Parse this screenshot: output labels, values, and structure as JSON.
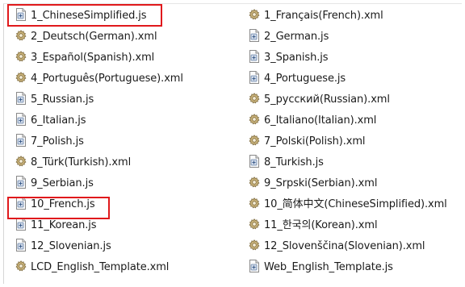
{
  "explorer": {
    "left_column": [
      {
        "name": "1_ChineseSimplified.js",
        "icon": "js-script-icon",
        "highlighted": true
      },
      {
        "name": "2_Deutsch(German).xml",
        "icon": "xml-gear-icon"
      },
      {
        "name": "3_Español(Spanish).xml",
        "icon": "xml-gear-icon"
      },
      {
        "name": "4_Português(Portuguese).xml",
        "icon": "xml-gear-icon"
      },
      {
        "name": "5_Russian.js",
        "icon": "js-script-icon"
      },
      {
        "name": "6_Italian.js",
        "icon": "js-script-icon"
      },
      {
        "name": "7_Polish.js",
        "icon": "js-script-icon"
      },
      {
        "name": "8_Türk(Turkish).xml",
        "icon": "xml-gear-icon"
      },
      {
        "name": "9_Serbian.js",
        "icon": "js-script-icon"
      },
      {
        "name": "10_French.js",
        "icon": "js-script-icon",
        "highlighted": true
      },
      {
        "name": "11_Korean.js",
        "icon": "js-script-icon"
      },
      {
        "name": "12_Slovenian.js",
        "icon": "js-script-icon"
      },
      {
        "name": "LCD_English_Template.xml",
        "icon": "xml-gear-icon"
      }
    ],
    "right_column": [
      {
        "name": "1_Français(French).xml",
        "icon": "xml-gear-icon"
      },
      {
        "name": "2_German.js",
        "icon": "js-script-icon"
      },
      {
        "name": "3_Spanish.js",
        "icon": "js-script-icon"
      },
      {
        "name": "4_Portuguese.js",
        "icon": "js-script-icon"
      },
      {
        "name": "5_русский(Russian).xml",
        "icon": "xml-gear-icon"
      },
      {
        "name": "6_Italiano(Italian).xml",
        "icon": "xml-gear-icon"
      },
      {
        "name": "7_Polski(Polish).xml",
        "icon": "xml-gear-icon"
      },
      {
        "name": "8_Turkish.js",
        "icon": "js-script-icon"
      },
      {
        "name": "9_Srpski(Serbian).xml",
        "icon": "xml-gear-icon"
      },
      {
        "name": "10_简体中文(ChineseSimplified).xml",
        "icon": "xml-gear-icon"
      },
      {
        "name": "11_한국의(Korean).xml",
        "icon": "xml-gear-icon"
      },
      {
        "name": "12_Slovenščina(Slovenian).xml",
        "icon": "xml-gear-icon"
      },
      {
        "name": "Web_English_Template.js",
        "icon": "js-script-icon"
      }
    ]
  },
  "colors": {
    "highlight_border": "#e0191c",
    "text": "#1a1a1a",
    "background": "#ffffff"
  }
}
